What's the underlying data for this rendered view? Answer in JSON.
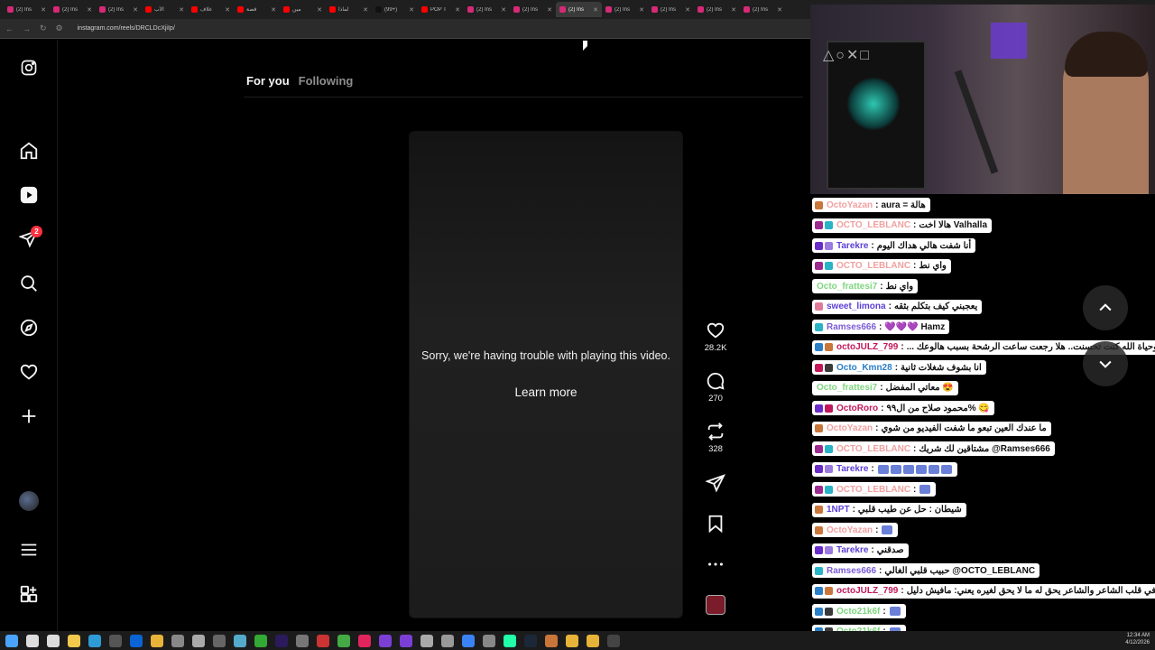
{
  "browser": {
    "tabs": [
      {
        "label": "(2) Ins",
        "color": "#d62976"
      },
      {
        "label": "(2) Ins",
        "color": "#d62976"
      },
      {
        "label": "(2) Ins",
        "color": "#d62976"
      },
      {
        "label": "الأب",
        "color": "#ff0000"
      },
      {
        "label": "غلاف",
        "color": "#ff0000"
      },
      {
        "label": "قصة",
        "color": "#ff0000"
      },
      {
        "label": "مين",
        "color": "#ff0000"
      },
      {
        "label": "لماذا",
        "color": "#ff0000"
      },
      {
        "label": "(99+)",
        "color": "#111111"
      },
      {
        "label": "POP T",
        "color": "#ff0000"
      },
      {
        "label": "(2) Ins",
        "color": "#d62976"
      },
      {
        "label": "(2) Ins",
        "color": "#d62976"
      },
      {
        "label": "(2) Ins",
        "color": "#d62976",
        "active": true
      },
      {
        "label": "(2) Ins",
        "color": "#d62976"
      },
      {
        "label": "(2) Ins",
        "color": "#d62976"
      },
      {
        "label": "(2) Ins",
        "color": "#d62976"
      },
      {
        "label": "(2) Ins",
        "color": "#d62976"
      }
    ],
    "url": "instagram.com/reels/DRCLDcXjiIp/"
  },
  "sidebar": {
    "notifications_badge": "2",
    "items": [
      "instagram-logo-icon",
      "home-icon",
      "reels-icon",
      "messages-icon",
      "search-icon",
      "explore-icon",
      "notifications-icon",
      "create-icon",
      "profile-avatar",
      "more-menu-icon",
      "apps-icon"
    ]
  },
  "feed": {
    "tab_for_you": "For you",
    "tab_following": "Following"
  },
  "video": {
    "error_text": "Sorry, we're having trouble with playing this video.",
    "learn_more": "Learn more"
  },
  "actions": {
    "likes": "28.2K",
    "comments": "270",
    "reposts": "328"
  },
  "chat": {
    "messages": [
      {
        "user": "OctoYazan",
        "color": "#f2a0a0",
        "text": "aura = هالة",
        "icons": [
          "#c8763a"
        ]
      },
      {
        "user": "OCTO_LEBLANC",
        "color": "#f2a0a0",
        "text": "هالا اخت Valhalla",
        "icons": [
          "#9c2a8f",
          "#2ab3c7"
        ]
      },
      {
        "user": "Tarekre",
        "color": "#5b3fd6",
        "text": "أنا شفت هالي هداك اليوم",
        "icons": [
          "#6a2cc9",
          "#9b7be0"
        ]
      },
      {
        "user": "OCTO_LEBLANC",
        "color": "#f2a0a0",
        "text": "واي نط",
        "icons": [
          "#9c2a8f",
          "#2ab3c7"
        ]
      },
      {
        "user": "Octo_frattesi7",
        "color": "#7ed67e",
        "text": "واي نط",
        "icons": []
      },
      {
        "user": "sweet_limona",
        "color": "#5b3fd6",
        "text": "يعجبني كيف بتكلم بثقه",
        "icons": [
          "#e07a9a"
        ]
      },
      {
        "user": "Ramses666",
        "color": "#7a5bd6",
        "text": "💜💜💜 Hamz",
        "icons": [
          "#2ab3c7"
        ]
      },
      {
        "user": "octoJULZ_799",
        "color": "#c2185b",
        "text": "... وحياة الله كنت تحسنت.. هلا رجعت ساعت الرشحة بسبب هالوعك",
        "icons": [
          "#2a7fc7",
          "#c8763a"
        ]
      },
      {
        "user": "Octo_Kmn28",
        "color": "#2a7fc7",
        "text": "انا بشوف شغلات ثانية",
        "icons": [
          "#c2185b",
          "#3a3a3a"
        ]
      },
      {
        "user": "Octo_frattesi7",
        "color": "#7ed67e",
        "text": "معاتي المفضل 😍",
        "icons": []
      },
      {
        "user": "OctoRoro",
        "color": "#c2185b",
        "text": "محمود صلاح من ال٩٩% 😋",
        "icons": [
          "#6a2cc9",
          "#c2185b"
        ]
      },
      {
        "user": "OctoYazan",
        "color": "#f2a0a0",
        "text": "ما عندك العين تبعو ما شفت الفيديو من شوي",
        "icons": [
          "#c8763a"
        ]
      },
      {
        "user": "OCTO_LEBLANC",
        "color": "#f2a0a0",
        "text": "مشتاقين لك شريك @Ramses666",
        "icons": [
          "#9c2a8f",
          "#2ab3c7"
        ]
      },
      {
        "user": "Tarekre",
        "color": "#5b3fd6",
        "text": "",
        "icons": [
          "#6a2cc9",
          "#9b7be0"
        ],
        "emotes": 6
      },
      {
        "user": "OCTO_LEBLANC",
        "color": "#f2a0a0",
        "text": "",
        "icons": [
          "#9c2a8f",
          "#2ab3c7"
        ],
        "emotes": 1
      },
      {
        "user": "1NPT",
        "color": "#5b3fd6",
        "text": "شيطان : حل عن طيب قلبي",
        "icons": [
          "#c8763a"
        ]
      },
      {
        "user": "OctoYazan",
        "color": "#f2a0a0",
        "text": "",
        "icons": [
          "#c8763a"
        ],
        "emotes": 1
      },
      {
        "user": "Tarekre",
        "color": "#5b3fd6",
        "text": "صدقني",
        "icons": [
          "#6a2cc9",
          "#9b7be0"
        ]
      },
      {
        "user": "Ramses666",
        "color": "#7a5bd6",
        "text": "حبيب قلبي الغالي @OCTO_LEBLANC",
        "icons": [
          "#2ab3c7"
        ]
      },
      {
        "user": "octoJULZ_799",
        "color": "#c2185b",
        "text": "الدليل في قلب الشاعر والشاعر يحق له ما لا يحق لغيره يعني: مافيش دليل",
        "icons": [
          "#2a7fc7",
          "#c8763a"
        ]
      },
      {
        "user": "Octo21k6f",
        "color": "#7ed67e",
        "text": "",
        "icons": [
          "#2a7fc7",
          "#3a3a3a"
        ],
        "emotes": 1
      },
      {
        "user": "Octo21k6f",
        "color": "#7ed67e",
        "text": "",
        "icons": [
          "#2a7fc7",
          "#3a3a3a"
        ],
        "emotes": 1
      }
    ]
  },
  "clock": {
    "time": "12:34 AM",
    "date": "4/12/2026"
  }
}
